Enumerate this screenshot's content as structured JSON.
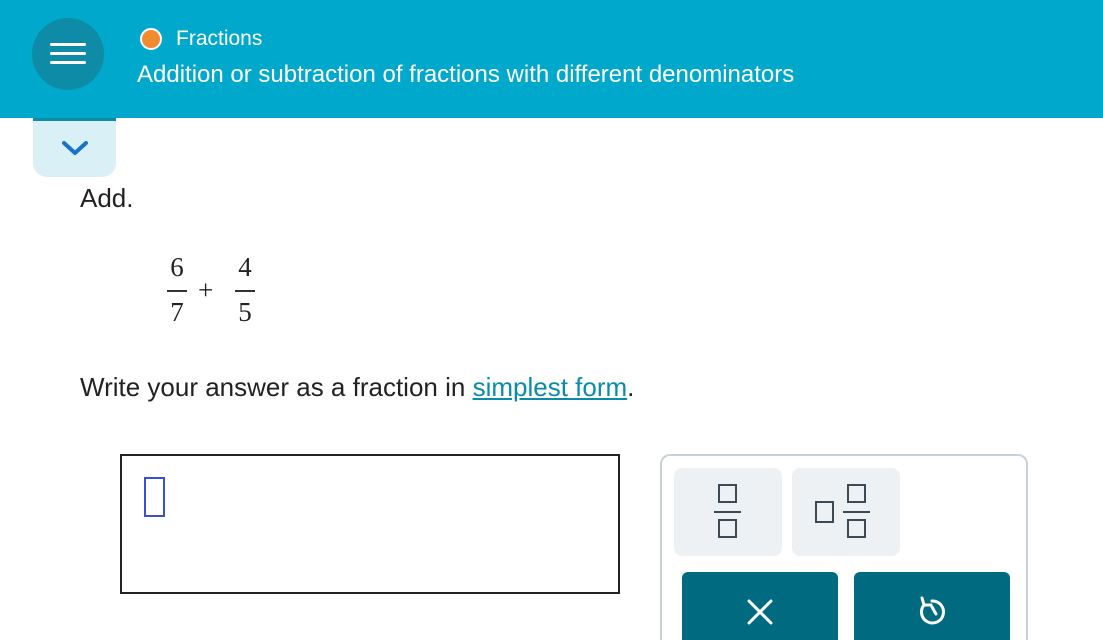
{
  "header": {
    "menu_icon": "hamburger-menu-icon",
    "topic": "Fractions",
    "topic_status_color": "#f28a30",
    "title": "Addition or subtraction of fractions with different denominators",
    "background_color": "#00a9cb"
  },
  "expand_tab": {
    "icon": "chevron-down-icon"
  },
  "problem": {
    "instruction": "Add.",
    "expression": {
      "fraction1": {
        "numerator": "6",
        "denominator": "7"
      },
      "operator": "+",
      "fraction2": {
        "numerator": "4",
        "denominator": "5"
      }
    },
    "directions_prefix": "Write your answer as a fraction in ",
    "directions_link": "simplest form",
    "directions_suffix": "."
  },
  "answer": {
    "value": ""
  },
  "tools": {
    "fraction_icon": "fraction-template-icon",
    "mixed_number_icon": "mixed-number-template-icon",
    "clear_icon": "close-icon",
    "undo_icon": "undo-icon",
    "action_color": "#006b80"
  }
}
